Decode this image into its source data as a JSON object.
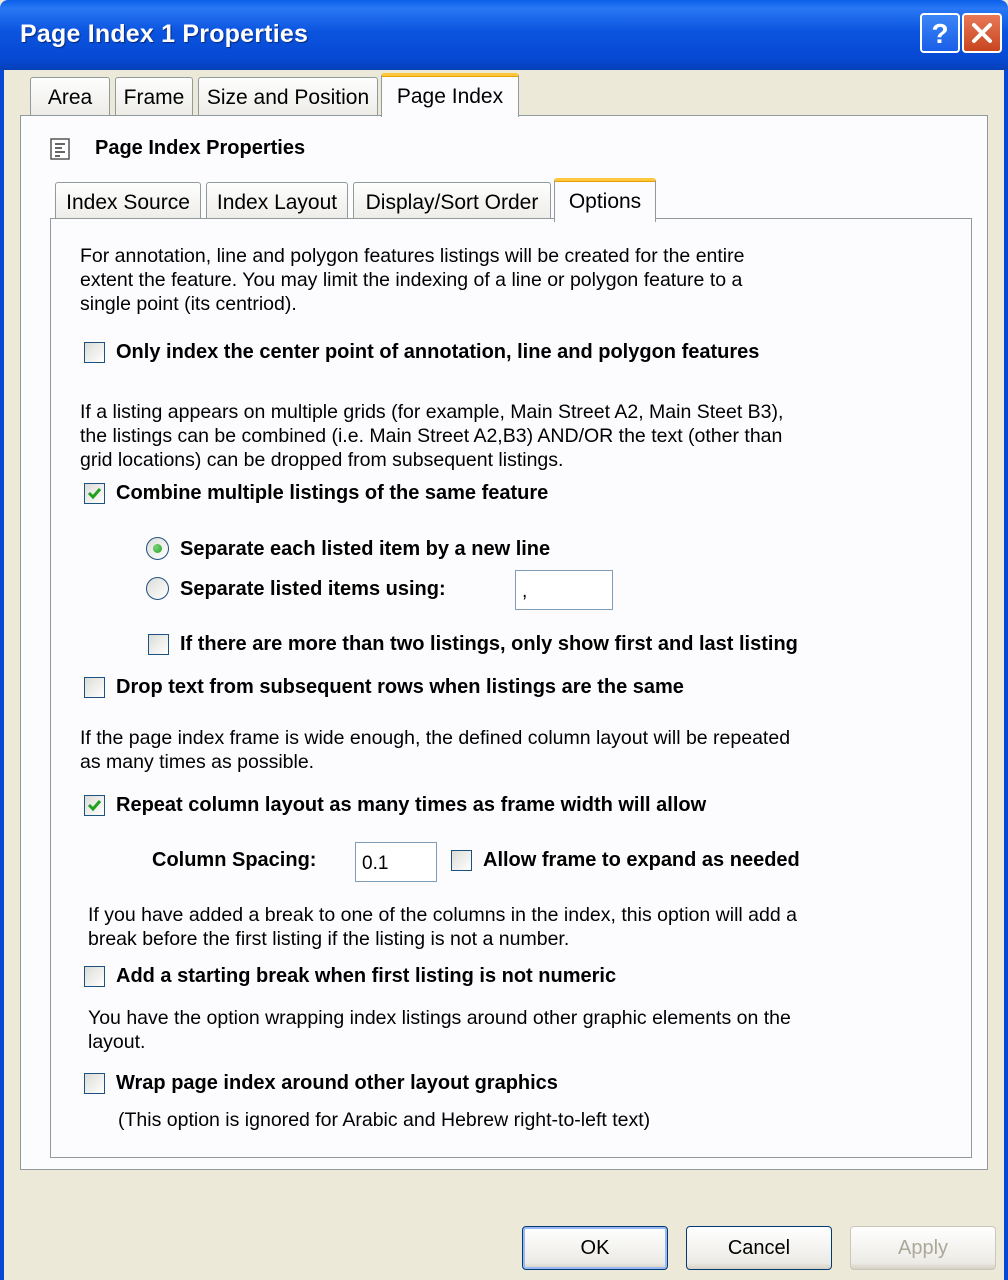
{
  "window": {
    "title": "Page Index 1 Properties"
  },
  "tabs": [
    {
      "label": "Area"
    },
    {
      "label": "Frame"
    },
    {
      "label": "Size and Position"
    },
    {
      "label": "Page Index"
    }
  ],
  "group": {
    "title": "Page Index Properties"
  },
  "subtabs": [
    {
      "label": "Index Source"
    },
    {
      "label": "Index Layout"
    },
    {
      "label": "Display/Sort Order"
    },
    {
      "label": "Options"
    }
  ],
  "options": {
    "intro_lines": [
      "For annotation, line and polygon features listings will be created for the entire",
      "extent the feature.  You may limit the indexing of a line or polygon feature to a",
      "single point (its centriod)."
    ],
    "center_point_label": "Only index the center point of annotation, line and polygon features",
    "center_point_checked": false,
    "combine_desc_lines": [
      "If a listing appears on multiple grids (for example, Main Street A2, Main Steet B3),",
      "the listings can be combined (i.e. Main Street A2,B3) AND/OR the text (other than",
      "grid locations) can be dropped from subsequent listings."
    ],
    "combine_label": "Combine multiple listings of the same feature",
    "combine_checked": true,
    "radio_new_line_label": "Separate each listed item by a  new line",
    "radio_using_label": "Separate listed items using:",
    "separator_value": ",",
    "first_last_label": "If there are more than two listings, only show first and last listing",
    "drop_text_label": "Drop text from subsequent rows when listings are the same",
    "repeat_desc_lines": [
      "If the page index frame is wide enough, the defined column layout will be repeated",
      "as many times as possible."
    ],
    "repeat_label": "Repeat column layout as many times as frame width will allow",
    "repeat_checked": true,
    "column_spacing_label": "Column Spacing:",
    "column_spacing_value": "0.1",
    "expand_label": "Allow frame to expand as needed",
    "break_desc_lines": [
      "If you have added a break to one of the columns in the index, this option will add a",
      "break before the first listing if the listing is not a number."
    ],
    "break_label": "Add a starting break when first listing is not numeric",
    "wrap_desc_lines": [
      "You have the option wrapping index listings around other graphic elements on the",
      "layout."
    ],
    "wrap_label": "Wrap page index around other layout graphics",
    "wrap_note": "(This option is ignored for Arabic and Hebrew right-to-left text)"
  },
  "buttons": {
    "ok": "OK",
    "cancel": "Cancel",
    "apply": "Apply"
  }
}
